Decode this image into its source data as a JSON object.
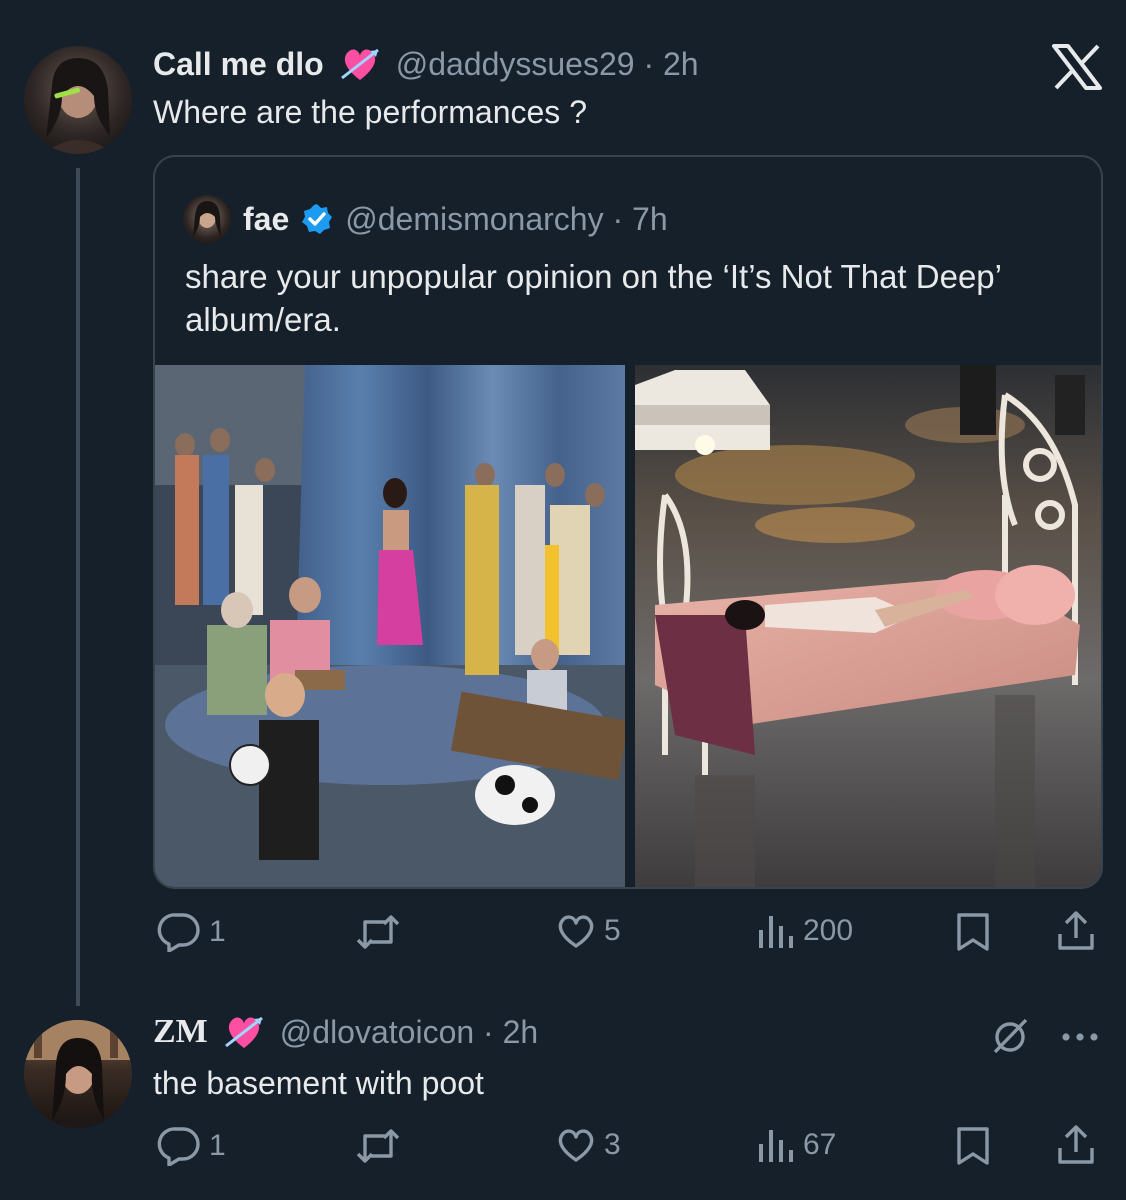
{
  "tweet1": {
    "display_name": "Call me dlo",
    "handle_time": "@daddyssues29 · 2h",
    "text": "Where are the performances ?",
    "name_emoji": "heart-with-arrow-icon"
  },
  "quote": {
    "display_name": "fae",
    "verified": true,
    "handle_time": "@demismonarchy · 7h",
    "text": "share your unpopular opinion on the ‘It’s Not That Deep’ album/era.",
    "images": [
      "photo-crowd-scene",
      "photo-bed-on-wet-street"
    ]
  },
  "tweet1_actions": {
    "replies": "1",
    "retweets": "",
    "likes": "5",
    "views": "200"
  },
  "tweet2": {
    "display_name": "ZM",
    "handle_time": "@dlovatoicon · 2h",
    "text": "the basement with poot",
    "name_emoji": "heart-with-arrow-icon"
  },
  "tweet2_actions": {
    "replies": "1",
    "retweets": "",
    "likes": "3",
    "views": "67"
  },
  "colors": {
    "background": "#15202b",
    "text": "#e7e9ea",
    "secondary": "#8b98a5",
    "verified": "#1d9bf0",
    "emoji_heart": "#ff4fa3"
  }
}
